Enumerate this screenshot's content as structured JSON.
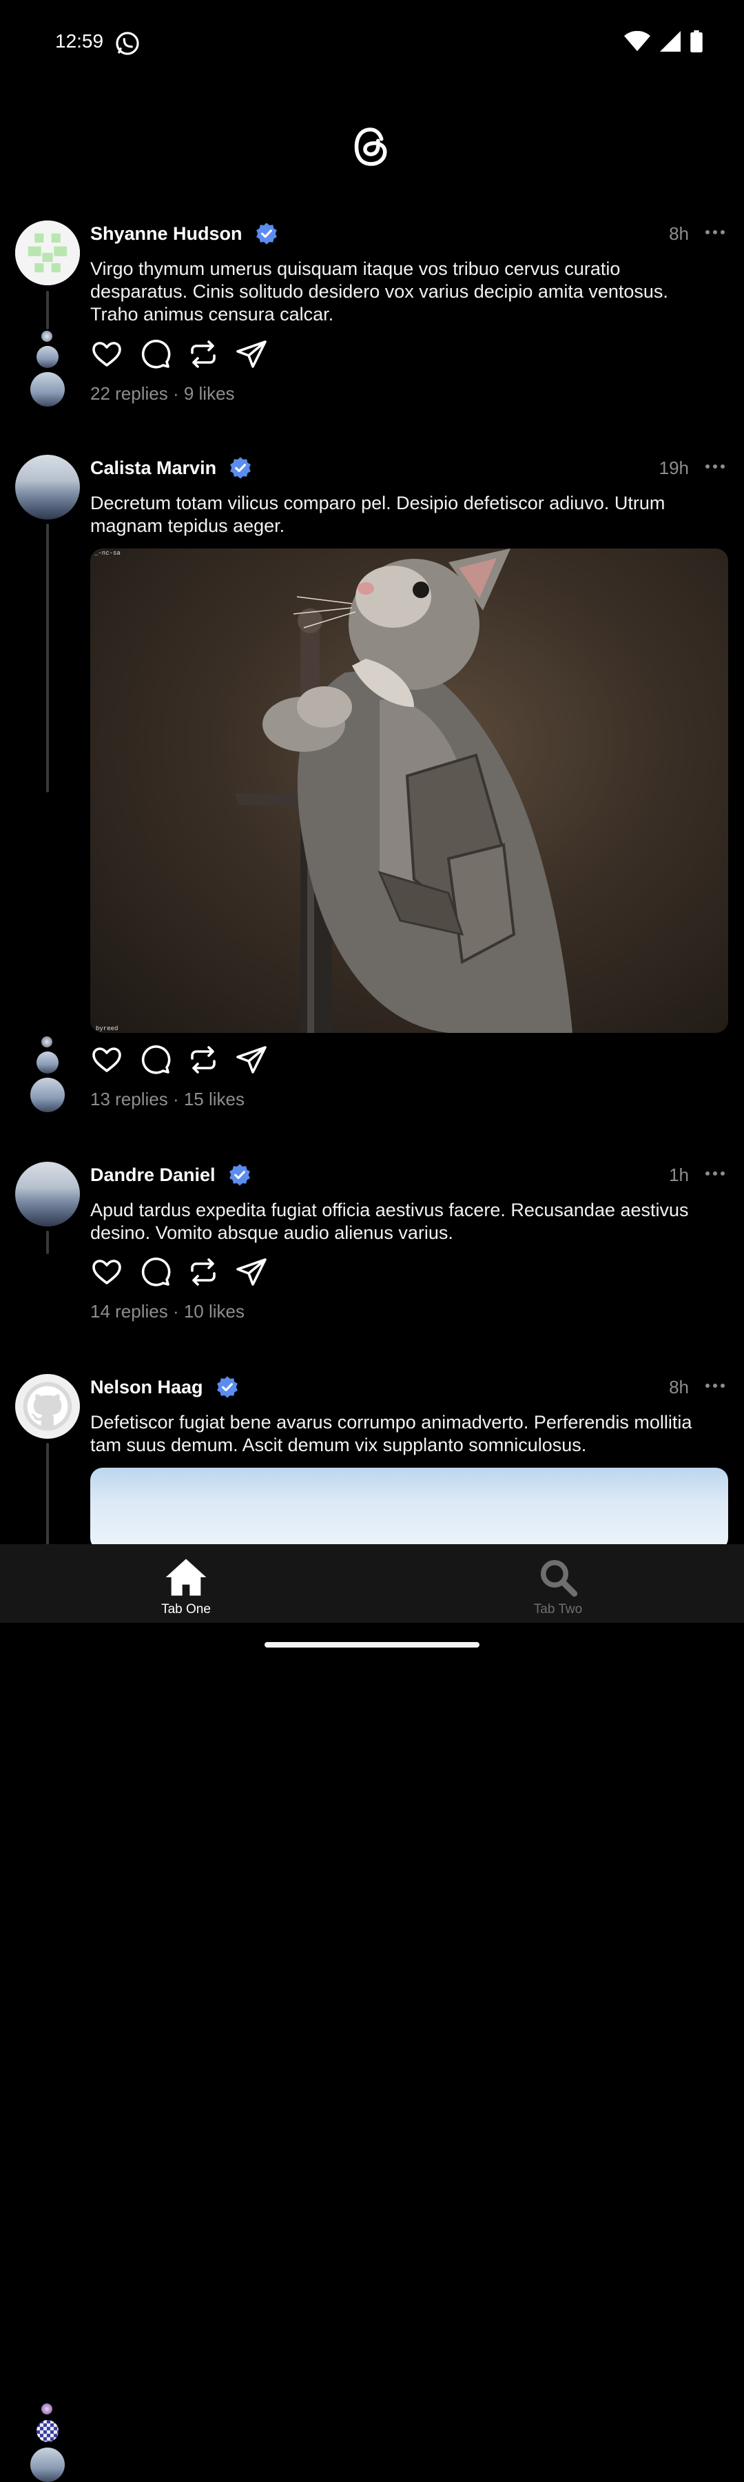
{
  "status_bar": {
    "time": "12:59",
    "icons": [
      "whatsapp-icon",
      "wifi-icon",
      "signal-icon",
      "battery-icon"
    ]
  },
  "app": {
    "logo": "threads-logo-icon"
  },
  "posts": [
    {
      "author": "Shyanne Hudson",
      "verified": true,
      "time": "8h",
      "text": "Virgo thymum umerus quisquam itaque vos tribuo cervus curatio desparatus. Cinis solitudo desidero vox varius decipio amita ventosus. Traho animus censura calcar.",
      "stats": "22 replies · 9 likes"
    },
    {
      "author": "Calista Marvin",
      "verified": true,
      "time": "19h",
      "text": "Decretum totam vilicus comparo pel. Desipio defetiscor adiuvo. Utrum magnam tepidus aeger.",
      "image": {
        "description_icon": "kitten-knight-photo",
        "tag_top": "_-nc-sa",
        "tag_bottom": "byreed"
      },
      "stats": "13 replies · 15 likes"
    },
    {
      "author": "Dandre Daniel",
      "verified": true,
      "time": "1h",
      "text": "Apud tardus expedita fugiat officia aestivus facere. Recusandae aestivus desino. Vomito absque audio alienus varius.",
      "stats": "14 replies · 10 likes"
    },
    {
      "author": "Nelson Haag",
      "verified": true,
      "time": "8h",
      "text": "Defetiscor fugiat bene avarus corrumpo animadverto. Perferendis mollitia tam suus demum. Ascit demum vix supplanto somniculosus."
    }
  ],
  "tabs": [
    {
      "label": "Tab One",
      "icon": "home-icon",
      "active": true
    },
    {
      "label": "Tab Two",
      "icon": "search-icon",
      "active": false
    }
  ],
  "colors": {
    "background": "#000000",
    "verified": "#5b8def",
    "muted": "#8e8e8e",
    "tab_bar": "#161616"
  }
}
